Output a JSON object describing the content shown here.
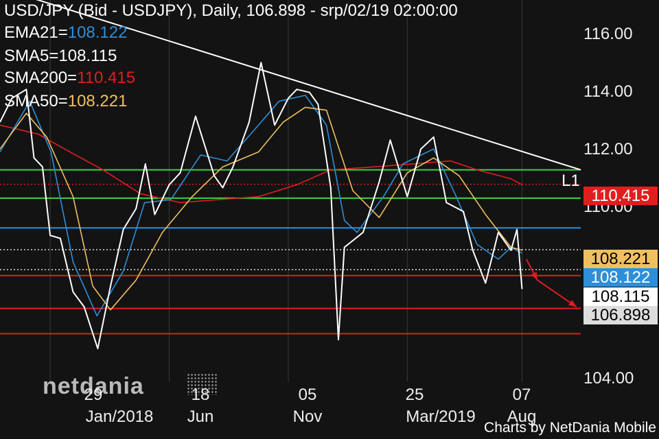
{
  "header": {
    "title": "USD/JPY (Bid - USDJPY),  Daily, 106.898 - srp/02/19 02:00:00",
    "indicators": [
      {
        "name": "EMA21=",
        "value": "108.122",
        "color": "#2e8fd8"
      },
      {
        "name": "SMA5=",
        "value": "108.115",
        "color": "#ffffff"
      },
      {
        "name": "SMA200=",
        "value": "110.415",
        "color": "#e01e1e"
      },
      {
        "name": "SMA50=",
        "value": "108.221",
        "color": "#f0c060"
      }
    ]
  },
  "axis": {
    "y_ticks": [
      "116.00",
      "114.00",
      "112.00",
      "110.00",
      "104.00"
    ],
    "x_ticks": [
      {
        "day": "29",
        "month": "Jan/2018"
      },
      {
        "day": "18",
        "month": "Jun"
      },
      {
        "day": "05",
        "month": "Nov"
      },
      {
        "day": "25",
        "month": "Mar/2019"
      },
      {
        "day": "07",
        "month": "Aug"
      }
    ]
  },
  "price_tags": [
    {
      "label": "110.415",
      "bg": "#e01e1e",
      "fg": "#ffffff"
    },
    {
      "label": "108.221",
      "bg": "#f0c060",
      "fg": "#000000"
    },
    {
      "label": "108.122",
      "bg": "#2e8fd8",
      "fg": "#ffffff"
    },
    {
      "label": "108.115",
      "bg": "#ffffff",
      "fg": "#000000"
    },
    {
      "label": "106.898",
      "bg": "#dddddd",
      "fg": "#000000"
    }
  ],
  "line_label": "L1",
  "branding": {
    "logo": "netdania",
    "credit": "Charts by NetDania Mobile"
  },
  "chart_data": {
    "type": "line",
    "title": "USD/JPY (Bid - USDJPY),  Daily, 106.898 - srp/02/19 02:00:00",
    "ylim": [
      103.8,
      116.6
    ],
    "x_range": [
      "2017-12-01",
      "2019-10-15"
    ],
    "grid": "vertical",
    "series": [
      {
        "name": "USD/JPY",
        "color": "#ffffff",
        "points": [
          [
            "2017-12-01",
            112.5
          ],
          [
            "2017-12-15",
            113.3
          ],
          [
            "2018-01-01",
            113.6
          ],
          [
            "2018-01-10",
            111.3
          ],
          [
            "2018-01-20",
            111.0
          ],
          [
            "2018-01-29",
            108.7
          ],
          [
            "2018-02-10",
            108.6
          ],
          [
            "2018-02-25",
            106.8
          ],
          [
            "2018-03-10",
            106.3
          ],
          [
            "2018-03-26",
            104.9
          ],
          [
            "2018-04-10",
            107.0
          ],
          [
            "2018-04-25",
            108.9
          ],
          [
            "2018-05-10",
            109.6
          ],
          [
            "2018-05-21",
            111.1
          ],
          [
            "2018-06-01",
            109.4
          ],
          [
            "2018-06-18",
            110.4
          ],
          [
            "2018-07-01",
            110.8
          ],
          [
            "2018-07-19",
            112.7
          ],
          [
            "2018-08-10",
            110.7
          ],
          [
            "2018-08-20",
            110.3
          ],
          [
            "2018-09-01",
            111.0
          ],
          [
            "2018-09-20",
            112.5
          ],
          [
            "2018-10-04",
            114.5
          ],
          [
            "2018-10-20",
            112.4
          ],
          [
            "2018-11-05",
            113.3
          ],
          [
            "2018-11-15",
            113.6
          ],
          [
            "2018-11-30",
            113.5
          ],
          [
            "2018-12-10",
            113.1
          ],
          [
            "2018-12-25",
            110.3
          ],
          [
            "2019-01-03",
            105.2
          ],
          [
            "2019-01-10",
            108.3
          ],
          [
            "2019-02-01",
            108.8
          ],
          [
            "2019-02-20",
            110.5
          ],
          [
            "2019-03-05",
            111.9
          ],
          [
            "2019-03-25",
            110.0
          ],
          [
            "2019-04-10",
            111.6
          ],
          [
            "2019-04-25",
            112.0
          ],
          [
            "2019-05-10",
            109.8
          ],
          [
            "2019-05-30",
            109.5
          ],
          [
            "2019-06-10",
            108.2
          ],
          [
            "2019-06-25",
            107.1
          ],
          [
            "2019-07-10",
            108.8
          ],
          [
            "2019-07-25",
            108.2
          ],
          [
            "2019-08-01",
            108.9
          ],
          [
            "2019-08-07",
            106.9
          ]
        ]
      },
      {
        "name": "SMA50",
        "color": "#f0c060",
        "points": [
          [
            "2017-12-01",
            111.6
          ],
          [
            "2018-01-01",
            112.8
          ],
          [
            "2018-01-25",
            112.0
          ],
          [
            "2018-02-25",
            110.0
          ],
          [
            "2018-03-20",
            107.0
          ],
          [
            "2018-04-10",
            106.2
          ],
          [
            "2018-05-10",
            107.2
          ],
          [
            "2018-06-10",
            108.8
          ],
          [
            "2018-07-15",
            110.0
          ],
          [
            "2018-08-20",
            111.0
          ],
          [
            "2018-10-01",
            111.5
          ],
          [
            "2018-10-30",
            112.5
          ],
          [
            "2018-11-25",
            113.0
          ],
          [
            "2018-12-20",
            112.9
          ],
          [
            "2019-01-20",
            110.2
          ],
          [
            "2019-02-20",
            109.3
          ],
          [
            "2019-03-25",
            110.8
          ],
          [
            "2019-04-25",
            111.3
          ],
          [
            "2019-05-25",
            110.7
          ],
          [
            "2019-06-25",
            109.4
          ],
          [
            "2019-07-25",
            108.3
          ],
          [
            "2019-08-07",
            108.2
          ]
        ]
      },
      {
        "name": "EMA21",
        "color": "#2e8fd8",
        "points": [
          [
            "2017-12-01",
            111.5
          ],
          [
            "2018-01-05",
            113.2
          ],
          [
            "2018-01-30",
            111.5
          ],
          [
            "2018-02-25",
            107.8
          ],
          [
            "2018-03-25",
            106.0
          ],
          [
            "2018-04-25",
            107.5
          ],
          [
            "2018-05-20",
            109.8
          ],
          [
            "2018-06-20",
            109.9
          ],
          [
            "2018-07-25",
            111.4
          ],
          [
            "2018-08-25",
            111.2
          ],
          [
            "2018-10-01",
            112.4
          ],
          [
            "2018-10-25",
            113.2
          ],
          [
            "2018-11-25",
            113.4
          ],
          [
            "2018-12-20",
            112.4
          ],
          [
            "2019-01-10",
            109.2
          ],
          [
            "2019-01-25",
            108.8
          ],
          [
            "2019-02-25",
            110.0
          ],
          [
            "2019-03-20",
            111.1
          ],
          [
            "2019-04-25",
            111.6
          ],
          [
            "2019-05-20",
            110.1
          ],
          [
            "2019-06-15",
            108.4
          ],
          [
            "2019-07-10",
            107.9
          ],
          [
            "2019-07-25",
            108.3
          ],
          [
            "2019-08-07",
            108.1
          ]
        ]
      },
      {
        "name": "SMA200",
        "color": "#e01e1e",
        "points": [
          [
            "2017-12-01",
            112.4
          ],
          [
            "2018-01-15",
            112.1
          ],
          [
            "2018-02-15",
            111.6
          ],
          [
            "2018-04-01",
            110.9
          ],
          [
            "2018-05-15",
            110.1
          ],
          [
            "2018-07-01",
            109.8
          ],
          [
            "2018-08-15",
            109.9
          ],
          [
            "2018-10-01",
            110.0
          ],
          [
            "2018-11-15",
            110.4
          ],
          [
            "2018-12-25",
            110.9
          ],
          [
            "2019-02-15",
            111.0
          ],
          [
            "2019-04-01",
            111.1
          ],
          [
            "2019-05-15",
            111.2
          ],
          [
            "2019-06-15",
            110.9
          ],
          [
            "2019-07-25",
            110.6
          ],
          [
            "2019-08-07",
            110.4
          ]
        ]
      }
    ],
    "horizontal_lines": [
      {
        "value": 110.9,
        "color": "#3ad43a"
      },
      {
        "value": 109.95,
        "color": "#3ad43a"
      },
      {
        "value": 110.415,
        "color": "#e01e1e",
        "style": "dotted"
      },
      {
        "value": 108.95,
        "color": "#2e8fd8"
      },
      {
        "value": 108.221,
        "color": "#dddddd",
        "style": "dotted"
      },
      {
        "value": 107.55,
        "color": "#dddddd",
        "style": "dotted"
      },
      {
        "value": 107.35,
        "color": "#e01e1e"
      },
      {
        "value": 106.25,
        "color": "#e01e1e"
      },
      {
        "value": 105.4,
        "color": "#e01e1e"
      }
    ],
    "trendline": {
      "color": "#ffffff",
      "from": [
        "2017-12-01",
        117.0
      ],
      "to": [
        "2019-10-15",
        110.9
      ]
    },
    "projection_arrows": [
      {
        "from": [
          "2019-08-12",
          107.9
        ],
        "to": [
          "2019-08-25",
          107.2
        ]
      },
      {
        "from": [
          "2019-08-25",
          107.2
        ],
        "to": [
          "2019-10-10",
          106.3
        ]
      }
    ],
    "vertical_gridlines_at": [
      "2018-01-29",
      "2018-06-18",
      "2018-11-05",
      "2019-03-25",
      "2019-08-07"
    ]
  }
}
